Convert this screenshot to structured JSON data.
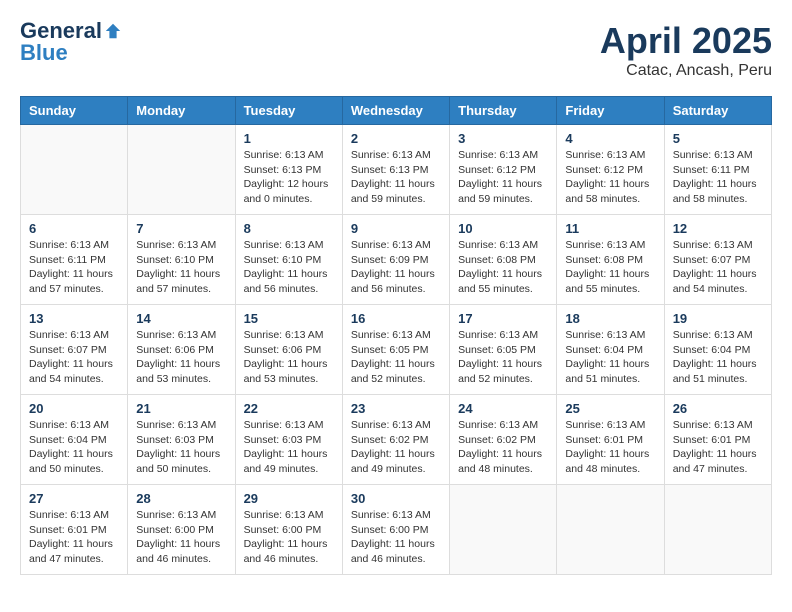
{
  "logo": {
    "general": "General",
    "blue": "Blue"
  },
  "title": "April 2025",
  "subtitle": "Catac, Ancash, Peru",
  "days_header": [
    "Sunday",
    "Monday",
    "Tuesday",
    "Wednesday",
    "Thursday",
    "Friday",
    "Saturday"
  ],
  "weeks": [
    [
      {
        "day": "",
        "info": ""
      },
      {
        "day": "",
        "info": ""
      },
      {
        "day": "1",
        "info": "Sunrise: 6:13 AM\nSunset: 6:13 PM\nDaylight: 12 hours\nand 0 minutes."
      },
      {
        "day": "2",
        "info": "Sunrise: 6:13 AM\nSunset: 6:13 PM\nDaylight: 11 hours\nand 59 minutes."
      },
      {
        "day": "3",
        "info": "Sunrise: 6:13 AM\nSunset: 6:12 PM\nDaylight: 11 hours\nand 59 minutes."
      },
      {
        "day": "4",
        "info": "Sunrise: 6:13 AM\nSunset: 6:12 PM\nDaylight: 11 hours\nand 58 minutes."
      },
      {
        "day": "5",
        "info": "Sunrise: 6:13 AM\nSunset: 6:11 PM\nDaylight: 11 hours\nand 58 minutes."
      }
    ],
    [
      {
        "day": "6",
        "info": "Sunrise: 6:13 AM\nSunset: 6:11 PM\nDaylight: 11 hours\nand 57 minutes."
      },
      {
        "day": "7",
        "info": "Sunrise: 6:13 AM\nSunset: 6:10 PM\nDaylight: 11 hours\nand 57 minutes."
      },
      {
        "day": "8",
        "info": "Sunrise: 6:13 AM\nSunset: 6:10 PM\nDaylight: 11 hours\nand 56 minutes."
      },
      {
        "day": "9",
        "info": "Sunrise: 6:13 AM\nSunset: 6:09 PM\nDaylight: 11 hours\nand 56 minutes."
      },
      {
        "day": "10",
        "info": "Sunrise: 6:13 AM\nSunset: 6:08 PM\nDaylight: 11 hours\nand 55 minutes."
      },
      {
        "day": "11",
        "info": "Sunrise: 6:13 AM\nSunset: 6:08 PM\nDaylight: 11 hours\nand 55 minutes."
      },
      {
        "day": "12",
        "info": "Sunrise: 6:13 AM\nSunset: 6:07 PM\nDaylight: 11 hours\nand 54 minutes."
      }
    ],
    [
      {
        "day": "13",
        "info": "Sunrise: 6:13 AM\nSunset: 6:07 PM\nDaylight: 11 hours\nand 54 minutes."
      },
      {
        "day": "14",
        "info": "Sunrise: 6:13 AM\nSunset: 6:06 PM\nDaylight: 11 hours\nand 53 minutes."
      },
      {
        "day": "15",
        "info": "Sunrise: 6:13 AM\nSunset: 6:06 PM\nDaylight: 11 hours\nand 53 minutes."
      },
      {
        "day": "16",
        "info": "Sunrise: 6:13 AM\nSunset: 6:05 PM\nDaylight: 11 hours\nand 52 minutes."
      },
      {
        "day": "17",
        "info": "Sunrise: 6:13 AM\nSunset: 6:05 PM\nDaylight: 11 hours\nand 52 minutes."
      },
      {
        "day": "18",
        "info": "Sunrise: 6:13 AM\nSunset: 6:04 PM\nDaylight: 11 hours\nand 51 minutes."
      },
      {
        "day": "19",
        "info": "Sunrise: 6:13 AM\nSunset: 6:04 PM\nDaylight: 11 hours\nand 51 minutes."
      }
    ],
    [
      {
        "day": "20",
        "info": "Sunrise: 6:13 AM\nSunset: 6:04 PM\nDaylight: 11 hours\nand 50 minutes."
      },
      {
        "day": "21",
        "info": "Sunrise: 6:13 AM\nSunset: 6:03 PM\nDaylight: 11 hours\nand 50 minutes."
      },
      {
        "day": "22",
        "info": "Sunrise: 6:13 AM\nSunset: 6:03 PM\nDaylight: 11 hours\nand 49 minutes."
      },
      {
        "day": "23",
        "info": "Sunrise: 6:13 AM\nSunset: 6:02 PM\nDaylight: 11 hours\nand 49 minutes."
      },
      {
        "day": "24",
        "info": "Sunrise: 6:13 AM\nSunset: 6:02 PM\nDaylight: 11 hours\nand 48 minutes."
      },
      {
        "day": "25",
        "info": "Sunrise: 6:13 AM\nSunset: 6:01 PM\nDaylight: 11 hours\nand 48 minutes."
      },
      {
        "day": "26",
        "info": "Sunrise: 6:13 AM\nSunset: 6:01 PM\nDaylight: 11 hours\nand 47 minutes."
      }
    ],
    [
      {
        "day": "27",
        "info": "Sunrise: 6:13 AM\nSunset: 6:01 PM\nDaylight: 11 hours\nand 47 minutes."
      },
      {
        "day": "28",
        "info": "Sunrise: 6:13 AM\nSunset: 6:00 PM\nDaylight: 11 hours\nand 46 minutes."
      },
      {
        "day": "29",
        "info": "Sunrise: 6:13 AM\nSunset: 6:00 PM\nDaylight: 11 hours\nand 46 minutes."
      },
      {
        "day": "30",
        "info": "Sunrise: 6:13 AM\nSunset: 6:00 PM\nDaylight: 11 hours\nand 46 minutes."
      },
      {
        "day": "",
        "info": ""
      },
      {
        "day": "",
        "info": ""
      },
      {
        "day": "",
        "info": ""
      }
    ]
  ]
}
